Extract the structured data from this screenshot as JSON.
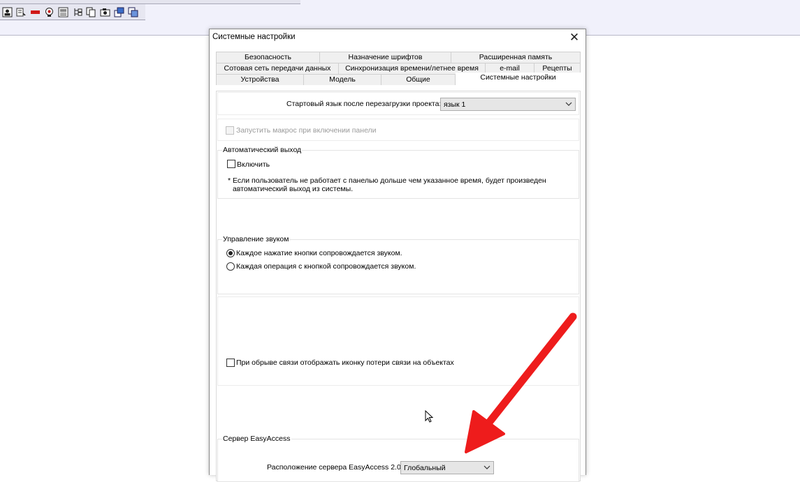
{
  "toolbar": {
    "icons": [
      "user-icon",
      "pointer-list-icon",
      "minus-icon",
      "alarm-icon",
      "image-icon",
      "tree-icon",
      "copy-icon",
      "camera-icon",
      "export-icon",
      "window-icon"
    ]
  },
  "dialog": {
    "title": "Системные настройки",
    "close_label": "✕",
    "tabs_row1": [
      "Безопасность",
      "Назначение шрифтов",
      "Расширенная память"
    ],
    "tabs_row2": [
      "Сотовая сеть передачи данных",
      "Синхронизация времени/летнее время",
      "e-mail",
      "Рецепты"
    ],
    "tabs_row3": [
      "Устройства",
      "Модель",
      "Общие",
      "Системные настройки"
    ],
    "active_tab": "Системные настройки",
    "startup_language": {
      "label": "Стартовый язык после перезагрузки проекта:",
      "value": "язык 1"
    },
    "run_macro": {
      "label": "Запустить макрос при включении панели",
      "checked": false,
      "enabled": false
    },
    "auto_logout": {
      "group_label": "Автоматический выход",
      "enable_label": "Включить",
      "enable_checked": false,
      "note_line1": "* Если пользователь не работает с панелью дольше чем указанное время, будет произведен",
      "note_line2": "автоматический выход из системы."
    },
    "sound": {
      "group_label": "Управление звуком",
      "option1": "Каждое нажатие кнопки сопровождается звуком.",
      "option2": "Каждая операция с кнопкой сопровождается звуком.",
      "selected": 1
    },
    "connection_loss": {
      "label": "При обрыве связи отображать иконку потери связи на объектах",
      "checked": false
    },
    "easyaccess": {
      "group_label": "Сервер EasyAccess",
      "location_label": "Расположение сервера EasyAccess 2.0 :",
      "location_value": "Глобальный"
    }
  },
  "colors": {
    "annotation_arrow": "#ee1c1c",
    "background_band": "#f1f1fb"
  }
}
